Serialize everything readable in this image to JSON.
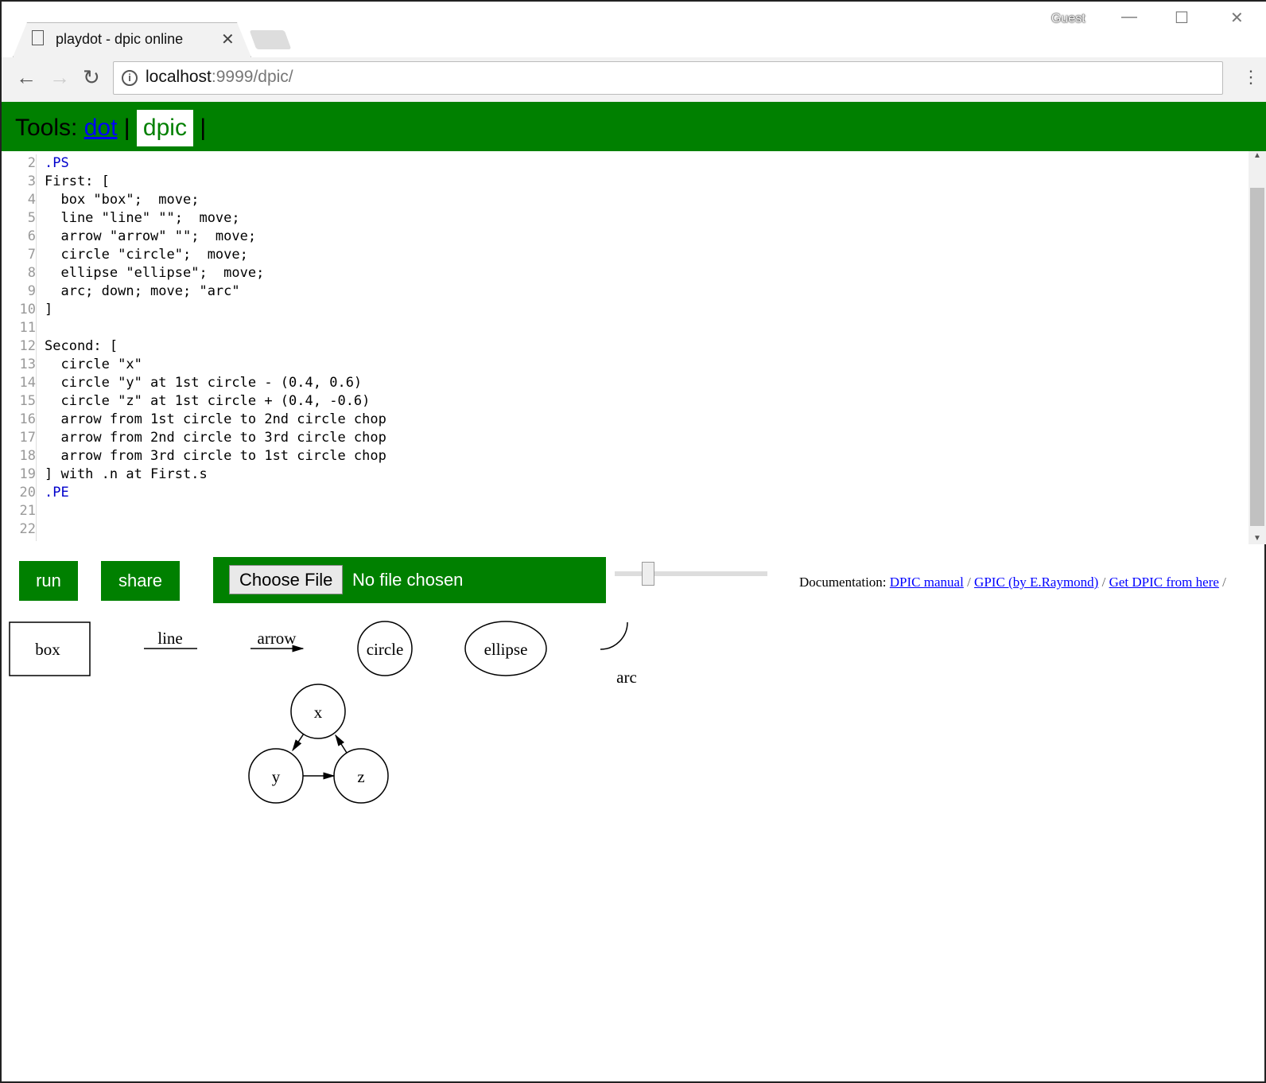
{
  "browser": {
    "tab_title": "playdot - dpic online",
    "profile": "Guest",
    "url_host": "localhost",
    "url_rest": ":9999/dpic/"
  },
  "header": {
    "label": "Tools:",
    "links": [
      {
        "label": "dot"
      },
      {
        "label": "dpic"
      }
    ],
    "sep": "|"
  },
  "editor": {
    "line_numbers": [
      "2",
      "3",
      "4",
      "5",
      "6",
      "7",
      "8",
      "9",
      "10",
      "11",
      "12",
      "13",
      "14",
      "15",
      "16",
      "17",
      "18",
      "19",
      "20",
      "21",
      "22"
    ],
    "lines": [
      ".PS",
      "First: [",
      "  box \"box\";  move;",
      "  line \"line\" \"\";  move;",
      "  arrow \"arrow\" \"\";  move;",
      "  circle \"circle\";  move;",
      "  ellipse \"ellipse\";  move;",
      "  arc; down; move; \"arc\"",
      "]",
      "",
      "Second: [",
      "  circle \"x\"",
      "  circle \"y\" at 1st circle - (0.4, 0.6)",
      "  circle \"z\" at 1st circle + (0.4, -0.6)",
      "  arrow from 1st circle to 2nd circle chop",
      "  arrow from 2nd circle to 3rd circle chop",
      "  arrow from 3rd circle to 1st circle chop",
      "] with .n at First.s",
      ".PE",
      "",
      ""
    ]
  },
  "controls": {
    "run": "run",
    "share": "share",
    "choose_file": "Choose File",
    "no_file": "No file chosen"
  },
  "docs": {
    "label": "Documentation:",
    "links": [
      "DPIC manual",
      "GPIC (by E.Raymond)",
      "Get DPIC from here"
    ],
    "sep": "/"
  },
  "output": {
    "box": "box",
    "line": "line",
    "arrow": "arrow",
    "circle": "circle",
    "ellipse": "ellipse",
    "arc": "arc",
    "x": "x",
    "y": "y",
    "z": "z"
  }
}
